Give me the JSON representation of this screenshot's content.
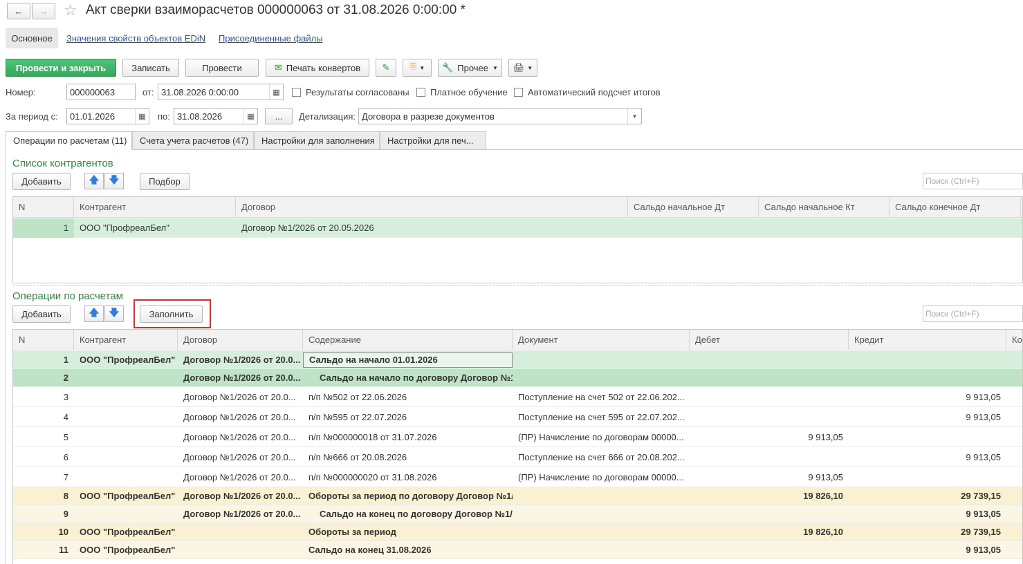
{
  "header": {
    "title": "Акт сверки взаиморасчетов 000000063 от 31.08.2026 0:00:00 *",
    "back_icon": "arrow-left",
    "forward_icon": "arrow-right",
    "star_icon": "star-outline"
  },
  "nav": {
    "main": "Основное",
    "edin": "Значения свойств объектов EDiN",
    "files": "Присоединенные файлы"
  },
  "toolbar": {
    "post_close": "Провести и закрыть",
    "save": "Записать",
    "post": "Провести",
    "print_envelopes": "Печать конвертов",
    "other": "Прочее"
  },
  "form": {
    "number_label": "Номер:",
    "number_value": "000000063",
    "from_label": "от:",
    "date_value": "31.08.2026  0:00:00",
    "agreed_label": "Результаты согласованы",
    "paid_label": "Платное обучение",
    "auto_label": "Автоматический подсчет итогов",
    "period_label": "За период с:",
    "period_from": "01.01.2026",
    "to_label": "по:",
    "period_to": "31.08.2026",
    "dots": "...",
    "detail_label": "Детализация:",
    "detail_value": "Договора в разрезе документов"
  },
  "tabs": [
    "Операции по расчетам (11)",
    "Счета учета расчетов (47)",
    "Настройки для заполнения",
    "Настройки для печ..."
  ],
  "contractors": {
    "title": "Список контрагентов",
    "add": "Добавить",
    "pick": "Подбор",
    "search": "Поиск (Ctrl+F)",
    "columns": [
      "N",
      "Контрагент",
      "Договор",
      "Сальдо начальное Дт",
      "Сальдо начальное Кт",
      "Сальдо конечное Дт"
    ],
    "rows": [
      {
        "n": "1",
        "contractor": "ООО \"ПрофреалБел\"",
        "contract": "Договор №1/2026 от 20.05.2026"
      }
    ]
  },
  "operations": {
    "title": "Операции по расчетам",
    "add": "Добавить",
    "fill": "Заполнить",
    "search": "Поиск (Ctrl+F)",
    "columns": [
      "N",
      "Контрагент",
      "Договор",
      "Содержание",
      "Документ",
      "Дебет",
      "Кредит",
      "Ко"
    ],
    "rows": [
      {
        "n": "1",
        "contractor": "ООО \"ПрофреалБел\"",
        "contract": "Договор №1/2026 от 20.0...",
        "content": "Сальдо на начало 01.01.2026",
        "doc": "",
        "debit": "",
        "credit": ""
      },
      {
        "n": "2",
        "contractor": "",
        "contract": "Договор №1/2026 от 20.0...",
        "content": "Сальдо на начало по договору Договор №1...",
        "doc": "",
        "debit": "",
        "credit": ""
      },
      {
        "n": "3",
        "contractor": "",
        "contract": "Договор №1/2026 от 20.0...",
        "content": "п/п №502 от 22.06.2026",
        "doc": "Поступление на счет 502 от 22.06.202...",
        "debit": "",
        "credit": "9 913,05"
      },
      {
        "n": "4",
        "contractor": "",
        "contract": "Договор №1/2026 от 20.0...",
        "content": "п/п №595 от 22.07.2026",
        "doc": "Поступление на счет 595 от 22.07.202...",
        "debit": "",
        "credit": "9 913,05"
      },
      {
        "n": "5",
        "contractor": "",
        "contract": "Договор №1/2026 от 20.0...",
        "content": "п/п №000000018 от 31.07.2026",
        "doc": "(ПР) Начисление по договорам 00000...",
        "debit": "9 913,05",
        "credit": ""
      },
      {
        "n": "6",
        "contractor": "",
        "contract": "Договор №1/2026 от 20.0...",
        "content": "п/п №666 от 20.08.2026",
        "doc": "Поступление на счет 666 от 20.08.202...",
        "debit": "",
        "credit": "9 913,05"
      },
      {
        "n": "7",
        "contractor": "",
        "contract": "Договор №1/2026 от 20.0...",
        "content": "п/п №000000020 от 31.08.2026",
        "doc": "(ПР) Начисление по договорам 00000...",
        "debit": "9 913,05",
        "credit": ""
      },
      {
        "n": "8",
        "contractor": "ООО \"ПрофреалБел\"",
        "contract": "Договор №1/2026 от 20.0...",
        "content": "Обороты за период по договору Договор №1/...",
        "doc": "",
        "debit": "19 826,10",
        "credit": "29 739,15"
      },
      {
        "n": "9",
        "contractor": "",
        "contract": "Договор №1/2026 от 20.0...",
        "content": "Сальдо на конец по договору Договор №1/...",
        "doc": "",
        "debit": "",
        "credit": "9 913,05"
      },
      {
        "n": "10",
        "contractor": "ООО \"ПрофреалБел\"",
        "contract": "",
        "content": "Обороты за период",
        "doc": "",
        "debit": "19 826,10",
        "credit": "29 739,15"
      },
      {
        "n": "11",
        "contractor": "ООО \"ПрофреалБел\"",
        "contract": "",
        "content": "Сальдо на конец 31.08.2026",
        "doc": "",
        "debit": "",
        "credit": "9 913,05"
      }
    ]
  },
  "colors": {
    "accent_green": "#34a85c",
    "section_green": "#2e8b3f",
    "highlight_red": "#d32f2f"
  }
}
